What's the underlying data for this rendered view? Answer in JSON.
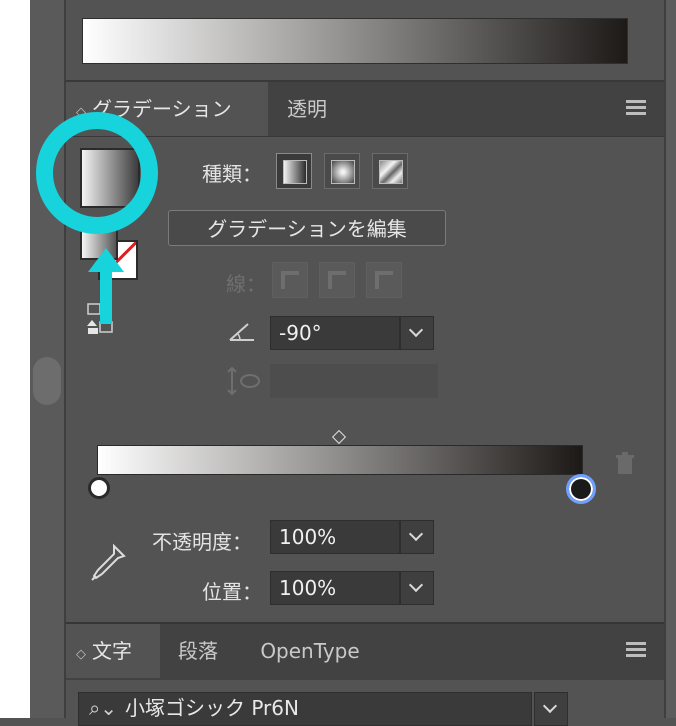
{
  "gradient_panel": {
    "tabs": [
      {
        "label": "グラデーション",
        "active": true
      },
      {
        "label": "透明",
        "active": false
      }
    ],
    "updown_glyph": "◇",
    "type_label": "種類：",
    "edit_gradient_label": "グラデーションを編集",
    "stroke_label": "線：",
    "angle_value": "-90°",
    "aspect_value": "",
    "opacity_label": "不透明度：",
    "opacity_value": "100%",
    "location_label": "位置：",
    "location_value": "100%",
    "gradient_start_color": "#ffffff",
    "gradient_end_color": "#1d1917"
  },
  "character_panel": {
    "tabs": [
      {
        "label": "文字",
        "active": true
      },
      {
        "label": "段落",
        "active": false
      },
      {
        "label": "OpenType",
        "active": false
      }
    ],
    "font_name": "小塚ゴシック Pr6N"
  },
  "annotation": {
    "color": "#17d3dc"
  }
}
